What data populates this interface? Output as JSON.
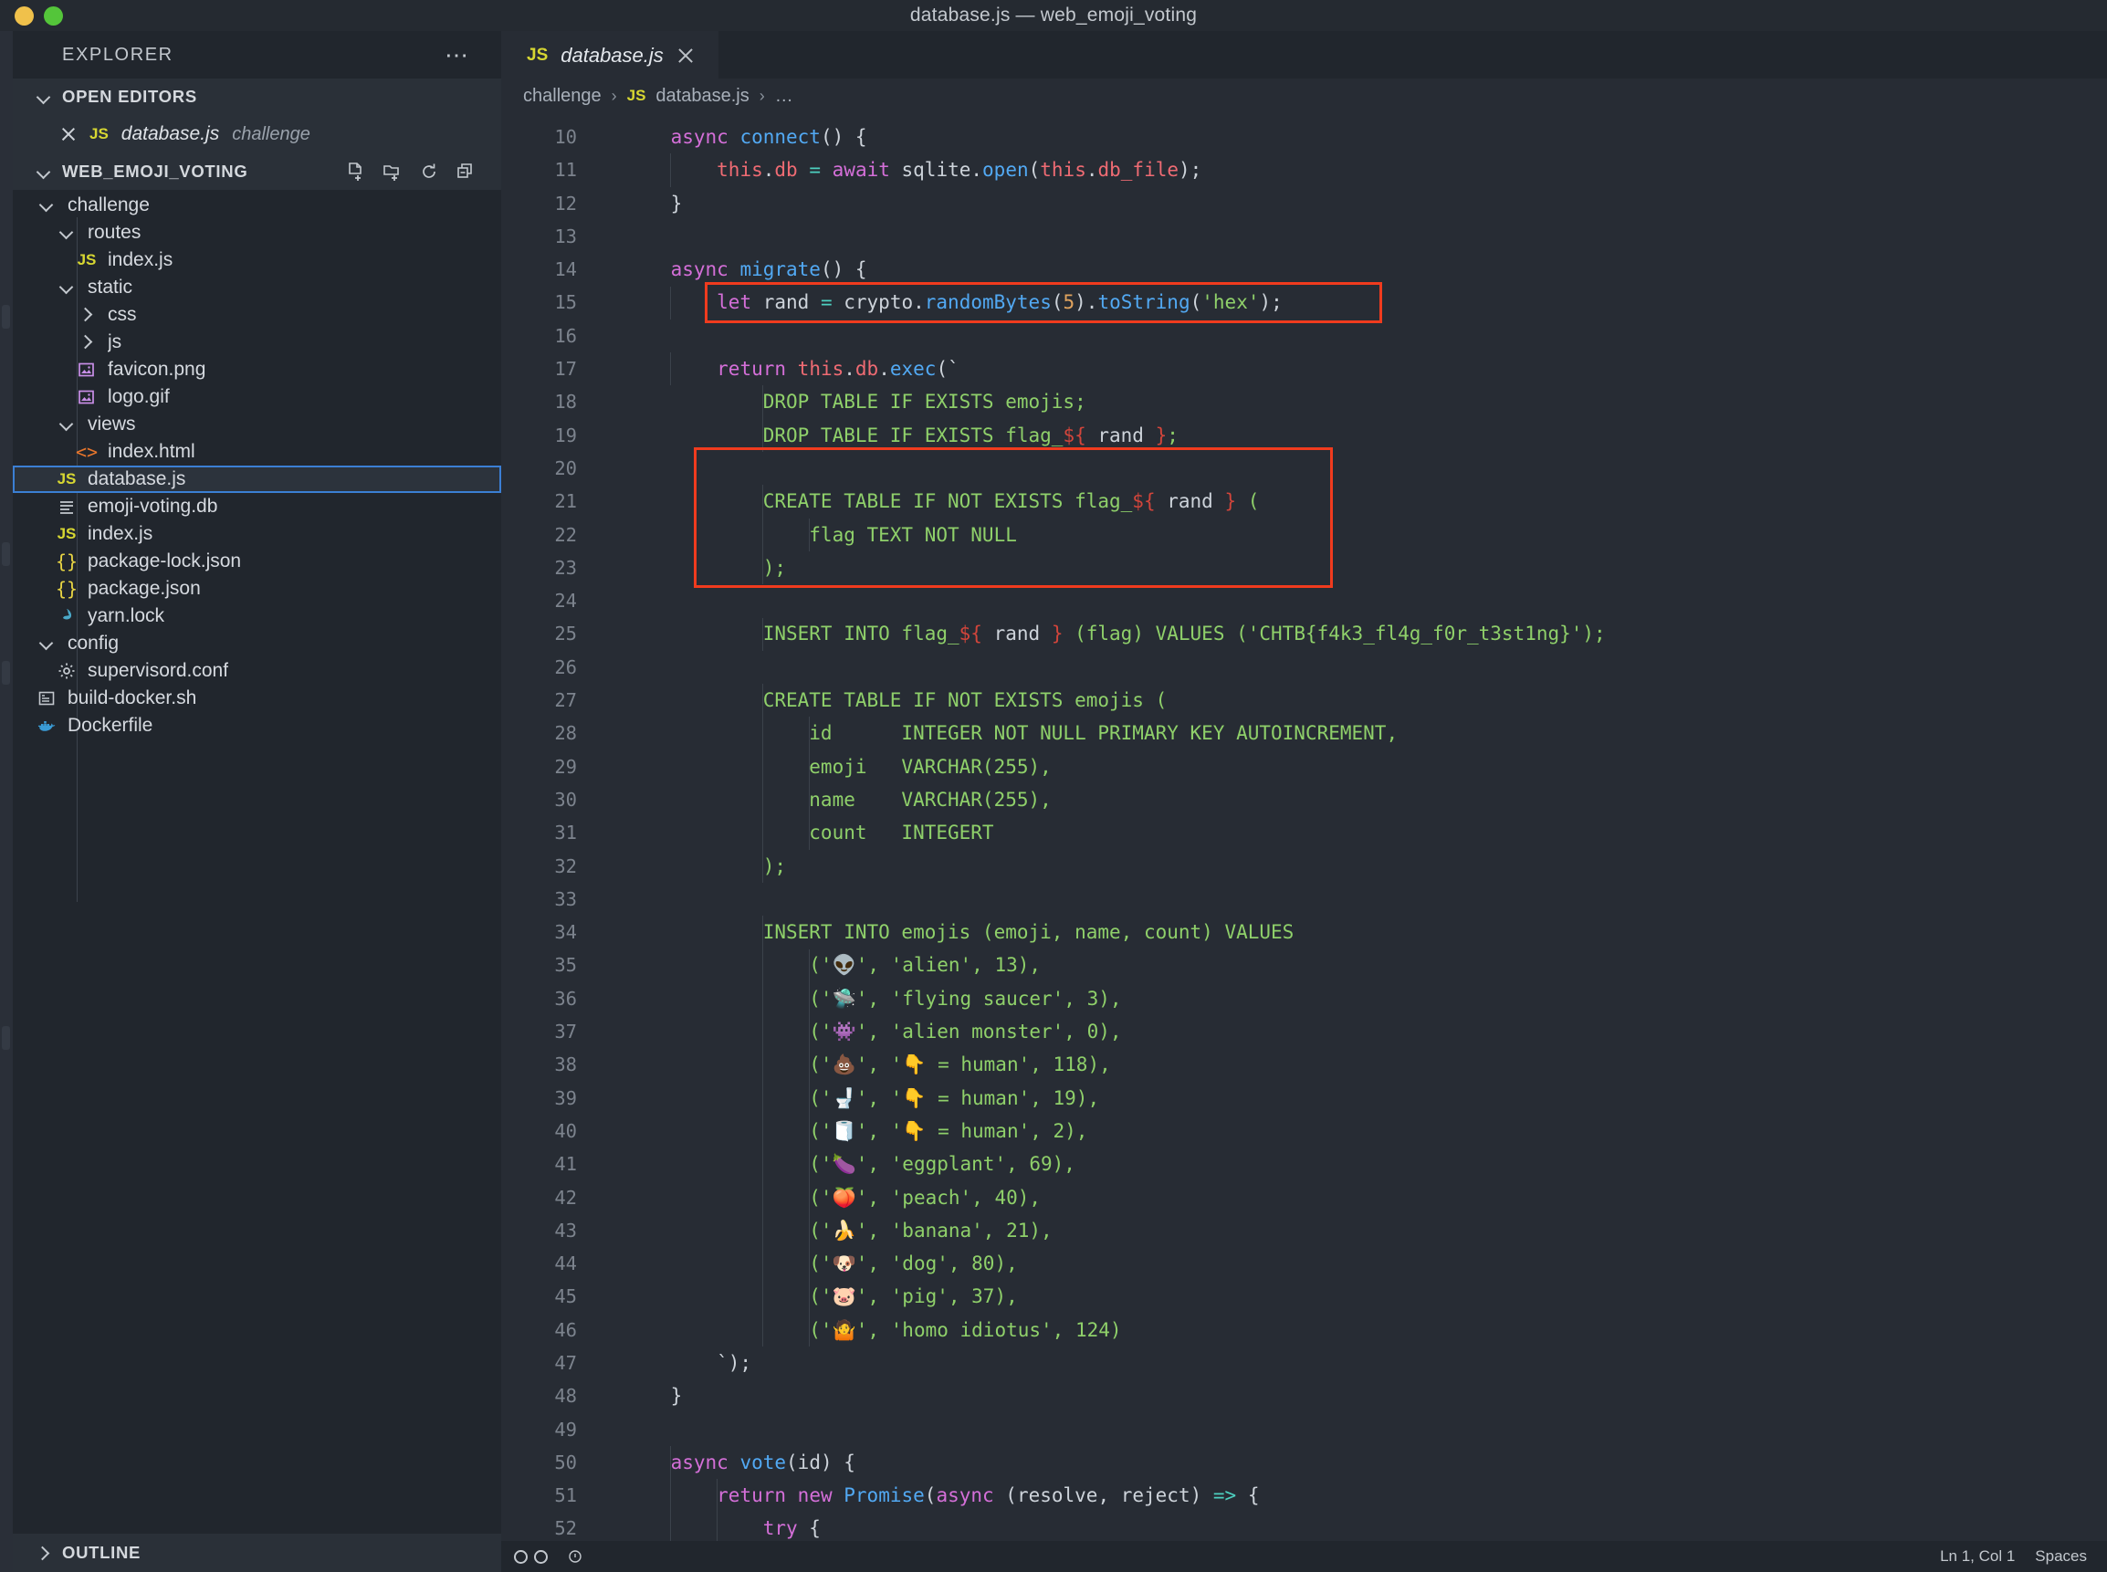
{
  "window": {
    "title": "database.js — web_emoji_voting"
  },
  "sidebar": {
    "header": {
      "title": "EXPLORER",
      "more_icon": "ellipsis-icon"
    },
    "open_editors": {
      "label": "OPEN EDITORS",
      "items": [
        {
          "name": "database.js",
          "folder": "challenge",
          "icon": "js-file-icon",
          "close_icon": "close-icon"
        }
      ]
    },
    "workspace": {
      "label": "WEB_EMOJI_VOTING",
      "actions": [
        "new-file-icon",
        "new-folder-icon",
        "refresh-icon",
        "collapse-all-icon"
      ],
      "tree": [
        {
          "label": "challenge",
          "type": "folder",
          "depth": 0,
          "expanded": true,
          "icon": "chevron-down-icon"
        },
        {
          "label": "routes",
          "type": "folder",
          "depth": 1,
          "expanded": true,
          "icon": "chevron-down-icon"
        },
        {
          "label": "index.js",
          "type": "js",
          "depth": 2,
          "icon": "js-file-icon"
        },
        {
          "label": "static",
          "type": "folder",
          "depth": 1,
          "expanded": true,
          "icon": "chevron-down-icon"
        },
        {
          "label": "css",
          "type": "folder",
          "depth": 2,
          "expanded": false,
          "icon": "chevron-right-icon"
        },
        {
          "label": "js",
          "type": "folder",
          "depth": 2,
          "expanded": false,
          "icon": "chevron-right-icon"
        },
        {
          "label": "favicon.png",
          "type": "image",
          "depth": 2,
          "icon": "image-file-icon"
        },
        {
          "label": "logo.gif",
          "type": "image",
          "depth": 2,
          "icon": "image-file-icon"
        },
        {
          "label": "views",
          "type": "folder",
          "depth": 1,
          "expanded": true,
          "icon": "chevron-down-icon"
        },
        {
          "label": "index.html",
          "type": "html",
          "depth": 2,
          "icon": "html-file-icon"
        },
        {
          "label": "database.js",
          "type": "js",
          "depth": 1,
          "icon": "js-file-icon",
          "selected": true
        },
        {
          "label": "emoji-voting.db",
          "type": "db",
          "depth": 1,
          "icon": "database-file-icon"
        },
        {
          "label": "index.js",
          "type": "js",
          "depth": 1,
          "icon": "js-file-icon"
        },
        {
          "label": "package-lock.json",
          "type": "json",
          "depth": 1,
          "icon": "json-file-icon"
        },
        {
          "label": "package.json",
          "type": "json",
          "depth": 1,
          "icon": "json-file-icon"
        },
        {
          "label": "yarn.lock",
          "type": "yarn",
          "depth": 1,
          "icon": "yarn-file-icon"
        },
        {
          "label": "config",
          "type": "folder",
          "depth": 0,
          "expanded": true,
          "icon": "chevron-down-icon"
        },
        {
          "label": "supervisord.conf",
          "type": "conf",
          "depth": 1,
          "icon": "gear-icon"
        },
        {
          "label": "build-docker.sh",
          "type": "shell",
          "depth": 0,
          "icon": "shell-file-icon"
        },
        {
          "label": "Dockerfile",
          "type": "docker",
          "depth": 0,
          "icon": "docker-icon"
        }
      ]
    },
    "outline": {
      "label": "OUTLINE",
      "icon": "chevron-right-icon"
    }
  },
  "editor": {
    "tab": {
      "label": "database.js",
      "icon": "js-file-icon",
      "close_icon": "close-icon"
    },
    "breadcrumb": [
      "challenge",
      "database.js",
      "…"
    ],
    "first_line_number": 10,
    "lines": [
      {
        "n": 10,
        "tokens": [
          {
            "t": "    ",
            "c": "pl"
          },
          {
            "t": "async ",
            "c": "kw"
          },
          {
            "t": "connect",
            "c": "fn"
          },
          {
            "t": "() {",
            "c": "pl"
          }
        ]
      },
      {
        "n": 11,
        "tokens": [
          {
            "t": "        ",
            "c": "pl"
          },
          {
            "t": "this",
            "c": "this"
          },
          {
            "t": ".",
            "c": "pl"
          },
          {
            "t": "db",
            "c": "this"
          },
          {
            "t": " ",
            "c": "pl"
          },
          {
            "t": "=",
            "c": "op"
          },
          {
            "t": " ",
            "c": "pl"
          },
          {
            "t": "await",
            "c": "kw"
          },
          {
            "t": " sqlite.",
            "c": "pl"
          },
          {
            "t": "open",
            "c": "fn"
          },
          {
            "t": "(",
            "c": "pl"
          },
          {
            "t": "this",
            "c": "this"
          },
          {
            "t": ".",
            "c": "pl"
          },
          {
            "t": "db_file",
            "c": "this"
          },
          {
            "t": ");",
            "c": "pl"
          }
        ]
      },
      {
        "n": 12,
        "tokens": [
          {
            "t": "    }",
            "c": "pl"
          }
        ]
      },
      {
        "n": 13,
        "tokens": []
      },
      {
        "n": 14,
        "tokens": [
          {
            "t": "    ",
            "c": "pl"
          },
          {
            "t": "async ",
            "c": "kw"
          },
          {
            "t": "migrate",
            "c": "fn"
          },
          {
            "t": "() {",
            "c": "pl"
          }
        ]
      },
      {
        "n": 15,
        "tokens": [
          {
            "t": "        ",
            "c": "pl"
          },
          {
            "t": "let",
            "c": "kw"
          },
          {
            "t": " rand ",
            "c": "pl"
          },
          {
            "t": "=",
            "c": "op"
          },
          {
            "t": " crypto.",
            "c": "pl"
          },
          {
            "t": "randomBytes",
            "c": "fn"
          },
          {
            "t": "(",
            "c": "pl"
          },
          {
            "t": "5",
            "c": "num"
          },
          {
            "t": ").",
            "c": "pl"
          },
          {
            "t": "toString",
            "c": "fn"
          },
          {
            "t": "(",
            "c": "pl"
          },
          {
            "t": "'hex'",
            "c": "str"
          },
          {
            "t": ");",
            "c": "pl"
          }
        ]
      },
      {
        "n": 16,
        "tokens": []
      },
      {
        "n": 17,
        "tokens": [
          {
            "t": "        ",
            "c": "pl"
          },
          {
            "t": "return",
            "c": "kw"
          },
          {
            "t": " ",
            "c": "pl"
          },
          {
            "t": "this",
            "c": "this"
          },
          {
            "t": ".",
            "c": "pl"
          },
          {
            "t": "db",
            "c": "this"
          },
          {
            "t": ".",
            "c": "pl"
          },
          {
            "t": "exec",
            "c": "fn"
          },
          {
            "t": "(`",
            "c": "pl"
          }
        ]
      },
      {
        "n": 18,
        "tokens": [
          {
            "t": "            DROP TABLE IF EXISTS emojis;",
            "c": "str"
          }
        ]
      },
      {
        "n": 19,
        "tokens": [
          {
            "t": "            DROP TABLE IF EXISTS flag_",
            "c": "str"
          },
          {
            "t": "${",
            "c": "tmpl"
          },
          {
            "t": " rand ",
            "c": "pl"
          },
          {
            "t": "}",
            "c": "tmpl"
          },
          {
            "t": ";",
            "c": "str"
          }
        ]
      },
      {
        "n": 20,
        "tokens": []
      },
      {
        "n": 21,
        "tokens": [
          {
            "t": "            CREATE TABLE IF NOT EXISTS flag_",
            "c": "str"
          },
          {
            "t": "${",
            "c": "tmpl"
          },
          {
            "t": " rand ",
            "c": "pl"
          },
          {
            "t": "}",
            "c": "tmpl"
          },
          {
            "t": " (",
            "c": "str"
          }
        ]
      },
      {
        "n": 22,
        "tokens": [
          {
            "t": "                flag TEXT NOT NULL",
            "c": "str"
          }
        ]
      },
      {
        "n": 23,
        "tokens": [
          {
            "t": "            );",
            "c": "str"
          }
        ]
      },
      {
        "n": 24,
        "tokens": []
      },
      {
        "n": 25,
        "tokens": [
          {
            "t": "            INSERT INTO flag_",
            "c": "str"
          },
          {
            "t": "${",
            "c": "tmpl"
          },
          {
            "t": " rand ",
            "c": "pl"
          },
          {
            "t": "}",
            "c": "tmpl"
          },
          {
            "t": " (flag) VALUES ('CHTB{f4k3_fl4g_f0r_t3st1ng}');",
            "c": "str"
          }
        ]
      },
      {
        "n": 26,
        "tokens": []
      },
      {
        "n": 27,
        "tokens": [
          {
            "t": "            CREATE TABLE IF NOT EXISTS emojis (",
            "c": "str"
          }
        ]
      },
      {
        "n": 28,
        "tokens": [
          {
            "t": "                id      INTEGER NOT NULL PRIMARY KEY AUTOINCREMENT,",
            "c": "str"
          }
        ]
      },
      {
        "n": 29,
        "tokens": [
          {
            "t": "                emoji   VARCHAR(255),",
            "c": "str"
          }
        ]
      },
      {
        "n": 30,
        "tokens": [
          {
            "t": "                name    VARCHAR(255),",
            "c": "str"
          }
        ]
      },
      {
        "n": 31,
        "tokens": [
          {
            "t": "                count   INTEGERT",
            "c": "str"
          }
        ]
      },
      {
        "n": 32,
        "tokens": [
          {
            "t": "            );",
            "c": "str"
          }
        ]
      },
      {
        "n": 33,
        "tokens": []
      },
      {
        "n": 34,
        "tokens": [
          {
            "t": "            INSERT INTO emojis (emoji, name, count) VALUES",
            "c": "str"
          }
        ]
      },
      {
        "n": 35,
        "tokens": [
          {
            "t": "                ('👽', 'alien', 13),",
            "c": "str"
          }
        ]
      },
      {
        "n": 36,
        "tokens": [
          {
            "t": "                ('🛸', 'flying saucer', 3),",
            "c": "str"
          }
        ]
      },
      {
        "n": 37,
        "tokens": [
          {
            "t": "                ('👾', 'alien monster', 0),",
            "c": "str"
          }
        ]
      },
      {
        "n": 38,
        "tokens": [
          {
            "t": "                ('💩', '👇 = human', 118),",
            "c": "str"
          }
        ]
      },
      {
        "n": 39,
        "tokens": [
          {
            "t": "                ('🚽', '👇 = human', 19),",
            "c": "str"
          }
        ]
      },
      {
        "n": 40,
        "tokens": [
          {
            "t": "                ('🧻', '👇 = human', 2),",
            "c": "str"
          }
        ]
      },
      {
        "n": 41,
        "tokens": [
          {
            "t": "                ('🍆', 'eggplant', 69),",
            "c": "str"
          }
        ]
      },
      {
        "n": 42,
        "tokens": [
          {
            "t": "                ('🍑', 'peach', 40),",
            "c": "str"
          }
        ]
      },
      {
        "n": 43,
        "tokens": [
          {
            "t": "                ('🍌', 'banana', 21),",
            "c": "str"
          }
        ]
      },
      {
        "n": 44,
        "tokens": [
          {
            "t": "                ('🐶', 'dog', 80),",
            "c": "str"
          }
        ]
      },
      {
        "n": 45,
        "tokens": [
          {
            "t": "                ('🐷', 'pig', 37),",
            "c": "str"
          }
        ]
      },
      {
        "n": 46,
        "tokens": [
          {
            "t": "                ('🤷', 'homo idiotus', 124)",
            "c": "str"
          }
        ]
      },
      {
        "n": 47,
        "tokens": [
          {
            "t": "        `);",
            "c": "pl"
          }
        ]
      },
      {
        "n": 48,
        "tokens": [
          {
            "t": "    }",
            "c": "pl"
          }
        ]
      },
      {
        "n": 49,
        "tokens": []
      },
      {
        "n": 50,
        "tokens": [
          {
            "t": "    ",
            "c": "pl"
          },
          {
            "t": "async ",
            "c": "kw"
          },
          {
            "t": "vote",
            "c": "fn"
          },
          {
            "t": "(",
            "c": "pl"
          },
          {
            "t": "id",
            "c": "var"
          },
          {
            "t": ") {",
            "c": "pl"
          }
        ]
      },
      {
        "n": 51,
        "tokens": [
          {
            "t": "        ",
            "c": "pl"
          },
          {
            "t": "return",
            "c": "kw"
          },
          {
            "t": " ",
            "c": "pl"
          },
          {
            "t": "new",
            "c": "kw"
          },
          {
            "t": " ",
            "c": "pl"
          },
          {
            "t": "Promise",
            "c": "fn"
          },
          {
            "t": "(",
            "c": "pl"
          },
          {
            "t": "async",
            "c": "kw"
          },
          {
            "t": " (resolve, reject) ",
            "c": "pl"
          },
          {
            "t": "=>",
            "c": "op"
          },
          {
            "t": " {",
            "c": "pl"
          }
        ]
      },
      {
        "n": 52,
        "tokens": [
          {
            "t": "            ",
            "c": "pl"
          },
          {
            "t": "try",
            "c": "kw"
          },
          {
            "t": " {",
            "c": "pl"
          }
        ]
      }
    ],
    "annotations": [
      {
        "name": "highlight-box-rand-line",
        "line_start": 15,
        "line_end": 15,
        "color": "#f03b1e"
      },
      {
        "name": "highlight-box-create-flag-table",
        "line_start": 20,
        "line_end": 23,
        "color": "#f03b1e"
      }
    ]
  },
  "statusbar": {
    "left": [
      "remote-icon",
      "problems-icon"
    ],
    "right": [
      "Ln 1, Col 1",
      "Spaces"
    ]
  },
  "colors": {
    "accent": "#3b7fd4",
    "annotation": "#f03b1e",
    "string": "#8fd06a",
    "keyword": "#d46fd8",
    "function": "#52a9f3",
    "this": "#ef6b73",
    "operator": "#4dd0c0",
    "template": "#d2453b"
  }
}
